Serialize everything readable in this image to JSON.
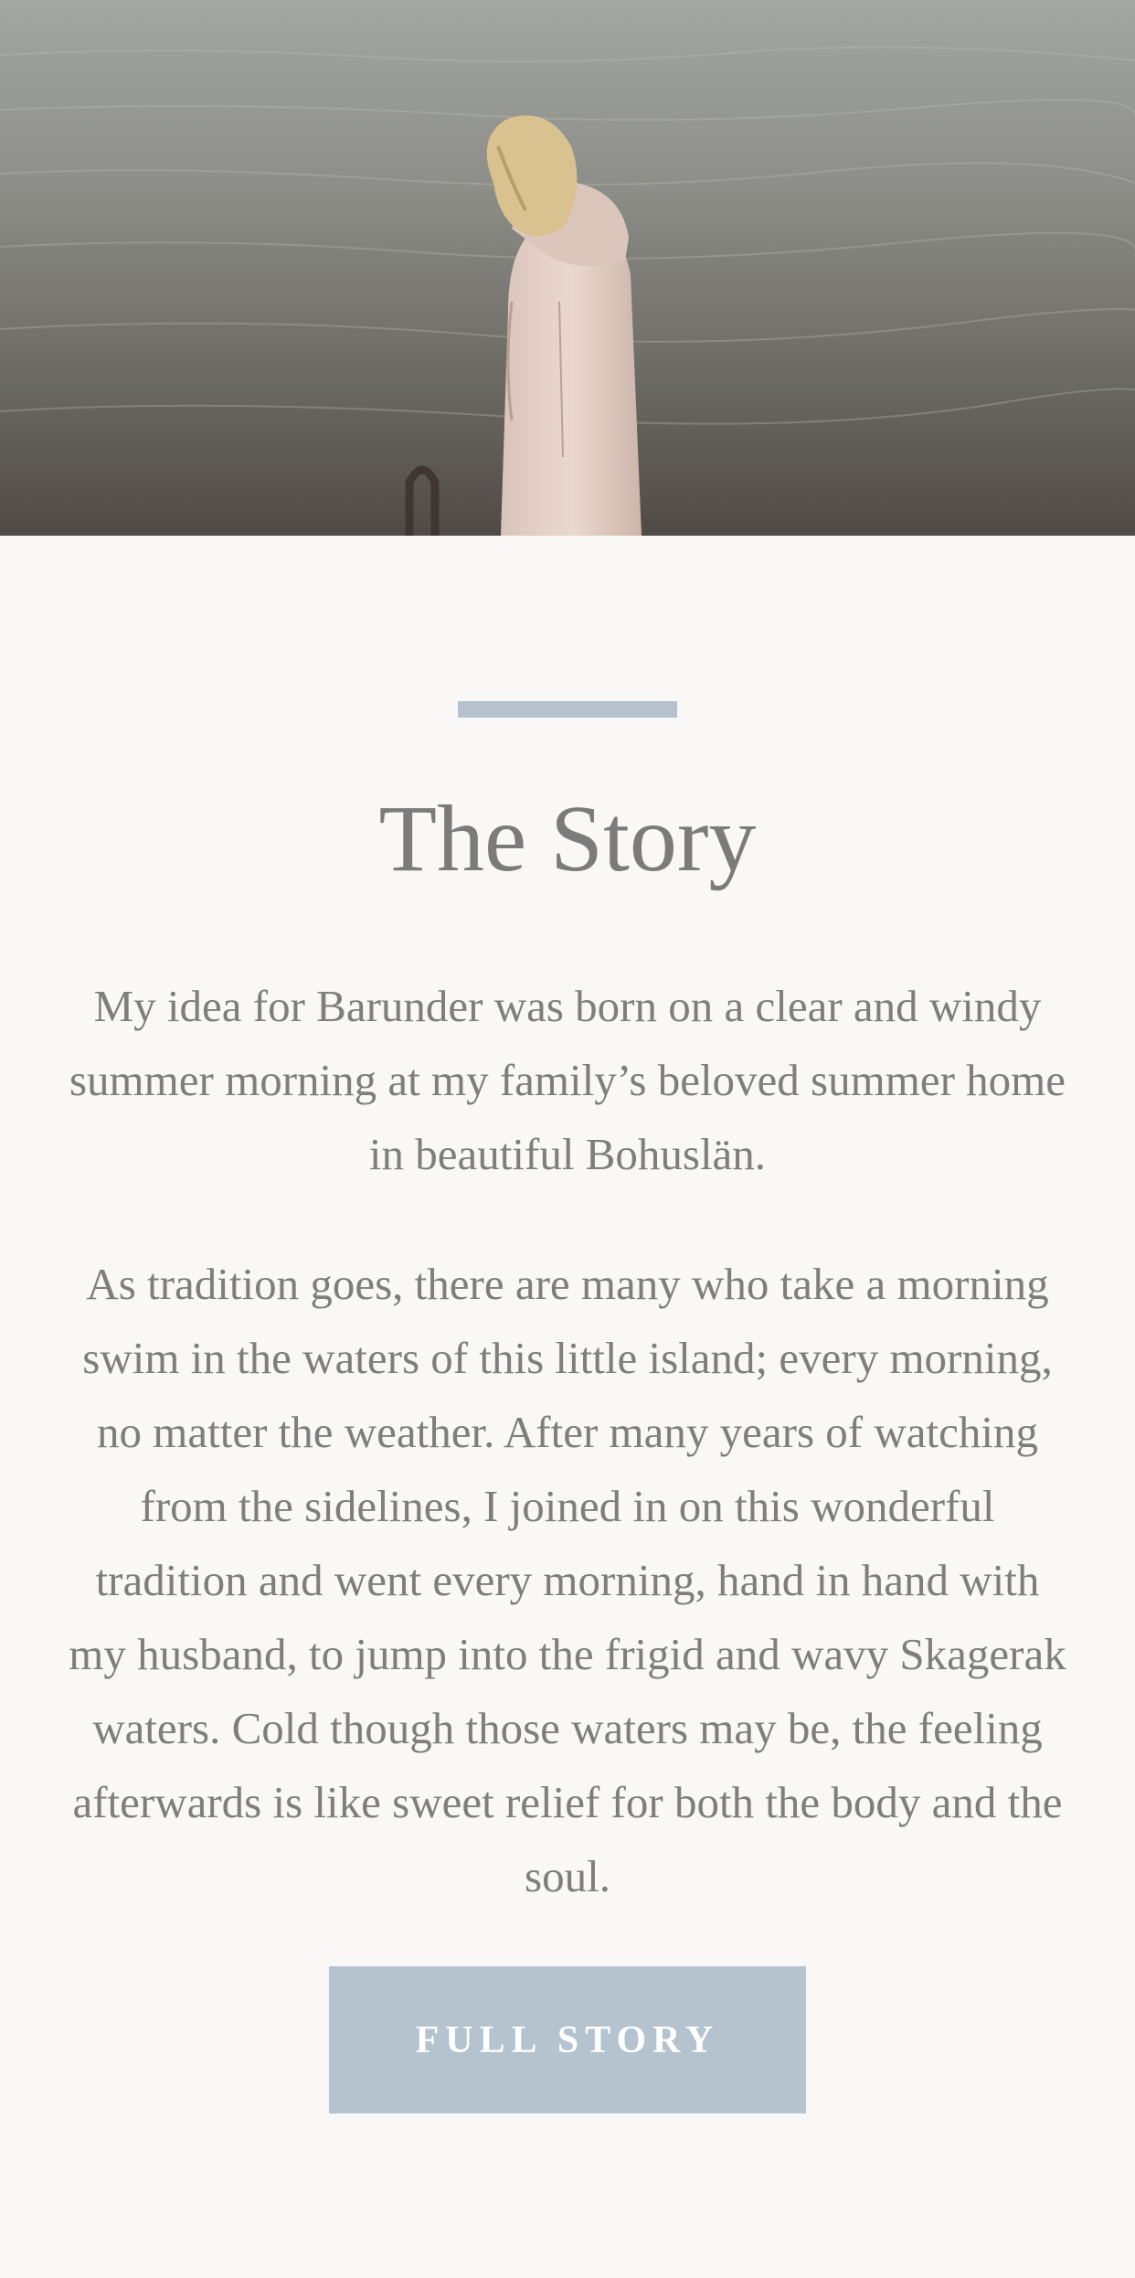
{
  "hero": {
    "image_description": "woman-in-hoodie-by-sea-icon"
  },
  "story": {
    "title": "The Story",
    "paragraphs": [
      "My idea for Barunder was born on a clear and windy summer morning at my family’s beloved summer home in beautiful Bohuslän.",
      "As tradition goes, there are many who take a morning swim in the waters of this little island; every morning, no matter the weather. After many years of watching from the sidelines, I joined in on this wonderful tradition and went every morning, hand in hand with my husband, to jump into the frigid and wavy Skagerak waters. Cold though those waters may be, the feeling afterwards is like sweet relief for both the body and the soul."
    ],
    "button_label": "FULL STORY"
  },
  "colors": {
    "background": "#f9f8f6",
    "accent": "#b5c2cd",
    "text": "#7d7d7d",
    "button_text": "#ffffff"
  }
}
